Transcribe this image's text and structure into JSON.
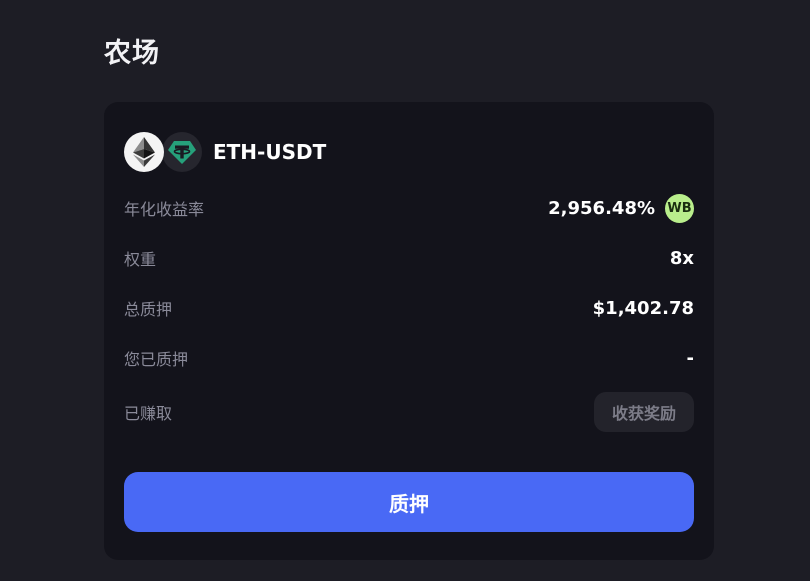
{
  "page": {
    "title": "农场"
  },
  "pair": {
    "name": "ETH-USDT",
    "token_a_icon": "ethereum-icon",
    "token_b_icon": "tether-icon"
  },
  "stats": {
    "apr_label": "年化收益率",
    "apr_value": "2,956.48%",
    "apr_badge": "WB",
    "weight_label": "权重",
    "weight_value": "8x",
    "total_staked_label": "总质押",
    "total_staked_value": "$1,402.78",
    "your_staked_label": "您已质押",
    "your_staked_value": "-",
    "earned_label": "已赚取"
  },
  "buttons": {
    "harvest_label": "收获奖励",
    "stake_label": "质押"
  },
  "colors": {
    "background": "#1d1d25",
    "card": "#13131b",
    "accent": "#4969f5",
    "badge": "#b9ee8c",
    "muted_text": "#8a8a99"
  }
}
